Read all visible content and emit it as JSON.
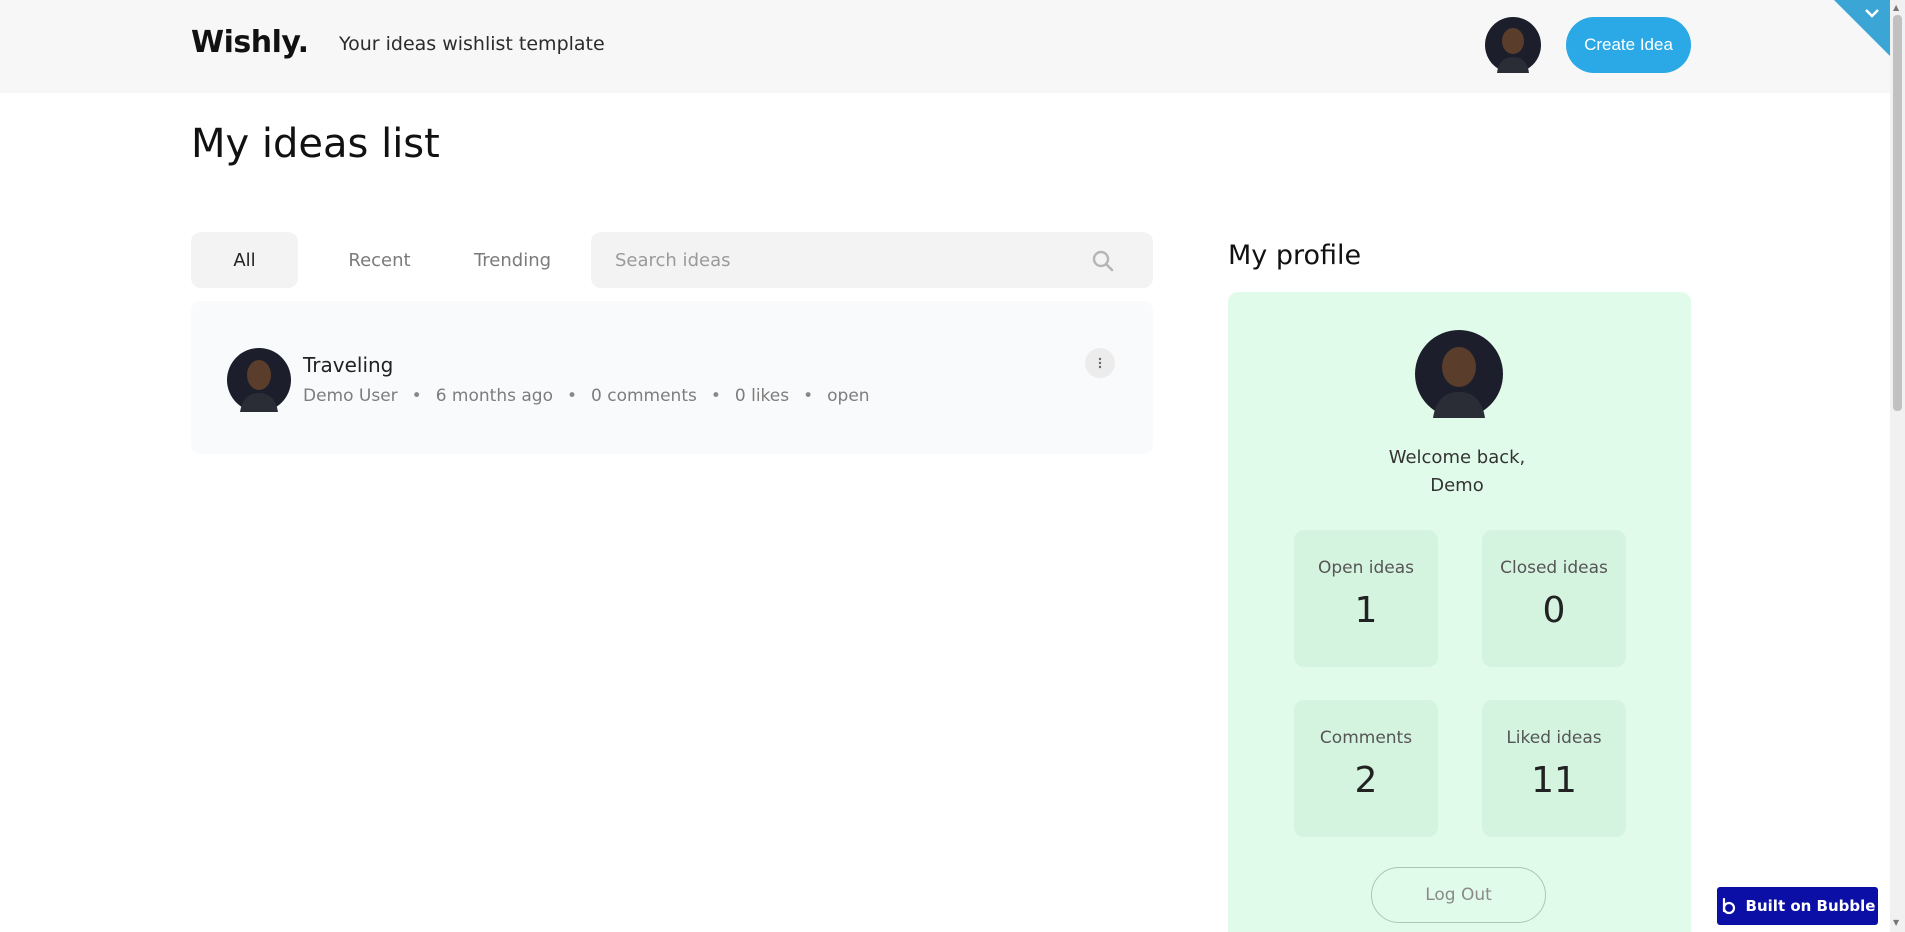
{
  "header": {
    "logo": "Wishly.",
    "tagline": "Your ideas wishlist template",
    "create_button": "Create Idea"
  },
  "page": {
    "title": "My ideas list"
  },
  "filters": {
    "tabs": [
      {
        "label": "All",
        "active": true
      },
      {
        "label": "Recent",
        "active": false
      },
      {
        "label": "Trending",
        "active": false
      }
    ],
    "search_placeholder": "Search ideas"
  },
  "ideas": [
    {
      "title": "Traveling",
      "author": "Demo User",
      "time": "6 months ago",
      "comments": "0 comments",
      "likes": "0 likes",
      "status": "open"
    }
  ],
  "profile": {
    "title": "My profile",
    "welcome_line1": "Welcome back,",
    "welcome_line2": "Demo",
    "stats": [
      {
        "label": "Open ideas",
        "value": "1"
      },
      {
        "label": "Closed ideas",
        "value": "0"
      },
      {
        "label": "Comments",
        "value": "2"
      },
      {
        "label": "Liked ideas",
        "value": "11"
      }
    ],
    "logout_label": "Log Out"
  },
  "badge": {
    "label": "Built on Bubble"
  },
  "colors": {
    "accent": "#2aa9e6",
    "profile_bg": "#e1fbea",
    "stat_bg": "#d5f4df",
    "bubble": "#0c0fa6"
  }
}
